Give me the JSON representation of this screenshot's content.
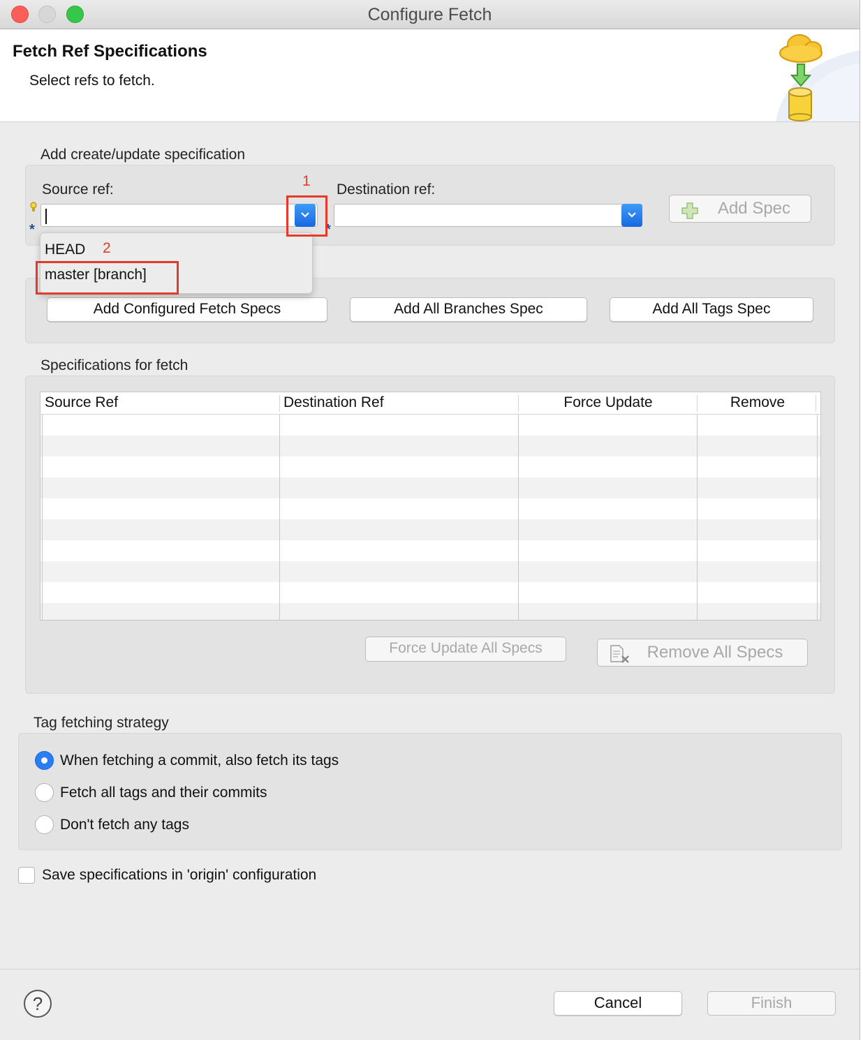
{
  "window": {
    "title": "Configure Fetch"
  },
  "header": {
    "title": "Fetch Ref Specifications",
    "subtitle": "Select refs to fetch."
  },
  "add_spec_section": {
    "label": "Add create/update specification",
    "source_label": "Source ref:",
    "source_value": "",
    "destination_label": "Destination ref:",
    "destination_value": "",
    "add_spec_button": "Add Spec",
    "required_marker": "*"
  },
  "source_dropdown": {
    "items": [
      "HEAD",
      "master [branch]"
    ]
  },
  "annotations": {
    "step1": "1",
    "step2": "2",
    "color": "#e33a2b"
  },
  "preset_buttons": {
    "configured": "Add Configured Fetch Specs",
    "branches": "Add All Branches Spec",
    "tags": "Add All Tags Spec"
  },
  "specs_section": {
    "label": "Specifications for fetch",
    "columns": [
      "Source Ref",
      "Destination Ref",
      "Force Update",
      "Remove"
    ],
    "rows": [],
    "force_update_all": "Force Update All Specs",
    "remove_all": "Remove All Specs"
  },
  "tag_strategy": {
    "label": "Tag fetching strategy",
    "options": [
      {
        "label": "When fetching a commit, also fetch its tags",
        "selected": true
      },
      {
        "label": "Fetch all tags and their commits",
        "selected": false
      },
      {
        "label": "Don't fetch any tags",
        "selected": false
      }
    ]
  },
  "save_config": {
    "label": "Save specifications in 'origin' configuration",
    "checked": false
  },
  "footer": {
    "help": "?",
    "cancel": "Cancel",
    "finish": "Finish"
  },
  "colors": {
    "accent": "#2c7df2",
    "annotation": "#e33a2b",
    "close": "#fc5f57",
    "maximize": "#34c749"
  }
}
